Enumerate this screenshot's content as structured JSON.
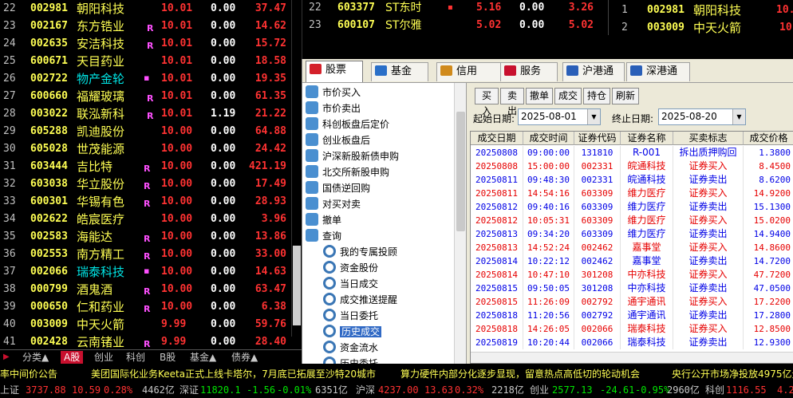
{
  "stock_list": [
    {
      "idx": "22",
      "code": "002981",
      "name": "朝阳科技",
      "mark": "",
      "price": "10.01",
      "vol": "0.00",
      "pct": "37.47",
      "name_color": "#ffff54"
    },
    {
      "idx": "23",
      "code": "002167",
      "name": "东方锆业",
      "mark": "R",
      "price": "10.01",
      "vol": "0.00",
      "pct": "14.62",
      "name_color": "#ffff54"
    },
    {
      "idx": "24",
      "code": "002635",
      "name": "安洁科技",
      "mark": "R",
      "price": "10.01",
      "vol": "0.00",
      "pct": "15.72",
      "name_color": "#ffff54"
    },
    {
      "idx": "25",
      "code": "600671",
      "name": "天目药业",
      "mark": "",
      "price": "10.01",
      "vol": "0.00",
      "pct": "18.58",
      "name_color": "#ffff54"
    },
    {
      "idx": "26",
      "code": "002722",
      "name": "物产金轮",
      "mark": "▪",
      "price": "10.01",
      "vol": "0.00",
      "pct": "19.35",
      "name_color": "#00e6e6"
    },
    {
      "idx": "27",
      "code": "600660",
      "name": "福耀玻璃",
      "mark": "R",
      "price": "10.01",
      "vol": "0.00",
      "pct": "61.35",
      "name_color": "#ffff54"
    },
    {
      "idx": "28",
      "code": "003022",
      "name": "联泓新科",
      "mark": "R",
      "price": "10.01",
      "vol": "1.19",
      "pct": "21.22",
      "name_color": "#ffff54"
    },
    {
      "idx": "29",
      "code": "605288",
      "name": "凯迪股份",
      "mark": "",
      "price": "10.00",
      "vol": "0.00",
      "pct": "64.88",
      "name_color": "#ffff54"
    },
    {
      "idx": "30",
      "code": "605028",
      "name": "世茂能源",
      "mark": "",
      "price": "10.00",
      "vol": "0.00",
      "pct": "24.42",
      "name_color": "#ffff54"
    },
    {
      "idx": "31",
      "code": "603444",
      "name": "吉比特",
      "mark": "R",
      "price": "10.00",
      "vol": "0.00",
      "pct": "421.19",
      "name_color": "#ffff54"
    },
    {
      "idx": "32",
      "code": "603038",
      "name": "华立股份",
      "mark": "R",
      "price": "10.00",
      "vol": "0.00",
      "pct": "17.49",
      "name_color": "#ffff54"
    },
    {
      "idx": "33",
      "code": "600301",
      "name": "华锡有色",
      "mark": "R",
      "price": "10.00",
      "vol": "0.00",
      "pct": "28.93",
      "name_color": "#ffff54"
    },
    {
      "idx": "34",
      "code": "002622",
      "name": "皓宸医疗",
      "mark": "",
      "price": "10.00",
      "vol": "0.00",
      "pct": "3.96",
      "name_color": "#ffff54"
    },
    {
      "idx": "35",
      "code": "002583",
      "name": "海能达",
      "mark": "R",
      "price": "10.00",
      "vol": "0.00",
      "pct": "13.86",
      "name_color": "#ffff54"
    },
    {
      "idx": "36",
      "code": "002553",
      "name": "南方精工",
      "mark": "R",
      "price": "10.00",
      "vol": "0.00",
      "pct": "33.00",
      "name_color": "#ffff54"
    },
    {
      "idx": "37",
      "code": "002066",
      "name": "瑞泰科技",
      "mark": "▪",
      "price": "10.00",
      "vol": "0.00",
      "pct": "14.63",
      "name_color": "#00e6e6"
    },
    {
      "idx": "38",
      "code": "000799",
      "name": "酒鬼酒",
      "mark": "R",
      "price": "10.00",
      "vol": "0.00",
      "pct": "63.47",
      "name_color": "#ffff54"
    },
    {
      "idx": "39",
      "code": "000650",
      "name": "仁和药业",
      "mark": "R",
      "price": "10.00",
      "vol": "0.00",
      "pct": "6.38",
      "name_color": "#ffff54"
    },
    {
      "idx": "40",
      "code": "003009",
      "name": "中天火箭",
      "mark": "",
      "price": "9.99",
      "vol": "0.00",
      "pct": "59.76",
      "name_color": "#ffff54"
    },
    {
      "idx": "41",
      "code": "002428",
      "name": "云南锗业",
      "mark": "R",
      "price": "9.99",
      "vol": "0.00",
      "pct": "28.40",
      "name_color": "#ffff54"
    }
  ],
  "bottom_tabs": [
    "分类▲",
    "A股",
    "创业",
    "科创",
    "B股",
    "基金▲",
    "债券▲"
  ],
  "top_mid": [
    {
      "idx": "22",
      "code": "603377",
      "name": "ST东时",
      "price": "5.16",
      "vol": "0.00",
      "pct": "3.26"
    },
    {
      "idx": "23",
      "code": "600107",
      "name": "ST尔雅",
      "price": "5.02",
      "vol": "0.00",
      "pct": "5.02"
    }
  ],
  "top_right": [
    {
      "idx": "1",
      "code": "002981",
      "name": "朝阳科技",
      "price": "10."
    },
    {
      "idx": "2",
      "code": "003009",
      "name": "中天火箭",
      "price": "10"
    }
  ],
  "trade_tabs": [
    {
      "label": "股票",
      "icon_color": "#d4202a"
    },
    {
      "label": "基金",
      "icon_color": "#2a6fc8"
    },
    {
      "label": "信用",
      "icon_color": "#d08a1c"
    },
    {
      "label": "服务",
      "icon_color": "#c8102e"
    },
    {
      "label": "沪港通",
      "icon_color": "#2a5fb8"
    },
    {
      "label": "深港通",
      "icon_color": "#2a5fb8"
    }
  ],
  "tree": [
    {
      "label": "市价买入",
      "icon": "#4a8fd0",
      "level": 0
    },
    {
      "label": "市价卖出",
      "icon": "#4a8fd0",
      "level": 0
    },
    {
      "label": "科创板盘后定价",
      "icon": "#4a8fd0",
      "level": 0
    },
    {
      "label": "创业板盘后",
      "icon": "#4a8fd0",
      "level": 0
    },
    {
      "label": "沪深新股新债申购",
      "icon": "#4a8fd0",
      "level": 0
    },
    {
      "label": "北交所新股申购",
      "icon": "#4a8fd0",
      "level": 0
    },
    {
      "label": "国债逆回购",
      "icon": "#4a8fd0",
      "level": 0
    },
    {
      "label": "对买对卖",
      "icon": "#4a8fd0",
      "level": 0
    },
    {
      "label": "撤单",
      "icon": "#4a8fd0",
      "level": 0
    },
    {
      "label": "查询",
      "icon": "#4a8fd0",
      "level": 0
    },
    {
      "label": "我的专属投顾",
      "icon": "gear",
      "level": 1
    },
    {
      "label": "资金股份",
      "icon": "gear",
      "level": 1
    },
    {
      "label": "当日成交",
      "icon": "gear",
      "level": 1
    },
    {
      "label": "成交推送提醒",
      "icon": "gear",
      "level": 1
    },
    {
      "label": "当日委托",
      "icon": "gear",
      "level": 1
    },
    {
      "label": "历史成交",
      "icon": "gear",
      "level": 1,
      "selected": true
    },
    {
      "label": "资金流水",
      "icon": "gear",
      "level": 1
    },
    {
      "label": "历史委托",
      "icon": "gear",
      "level": 1
    }
  ],
  "buttons": [
    "买入",
    "卖出",
    "撤单",
    "成交",
    "持仓",
    "刷新"
  ],
  "dates": {
    "start_label": "起始日期:",
    "start_value": "2025-08-01",
    "end_label": "终止日期:",
    "end_value": "2025-08-20"
  },
  "grid_headers": [
    "成交日期",
    "成交时间",
    "证券代码",
    "证券名称",
    "买卖标志",
    "成交价格"
  ],
  "grid_rows": [
    {
      "date": "20250808",
      "time": "09:00:00",
      "code": "131810",
      "name": "R-001",
      "flag": "拆出质押购回",
      "price": "1.3800",
      "type": "sell"
    },
    {
      "date": "20250808",
      "time": "15:00:00",
      "code": "002331",
      "name": "皖通科技",
      "flag": "证券买入",
      "price": "8.4500",
      "type": "buy"
    },
    {
      "date": "20250811",
      "time": "09:48:30",
      "code": "002331",
      "name": "皖通科技",
      "flag": "证券卖出",
      "price": "8.6200",
      "type": "sell"
    },
    {
      "date": "20250811",
      "time": "14:54:16",
      "code": "603309",
      "name": "维力医疗",
      "flag": "证券买入",
      "price": "14.9200",
      "type": "buy"
    },
    {
      "date": "20250812",
      "time": "09:40:16",
      "code": "603309",
      "name": "维力医疗",
      "flag": "证券卖出",
      "price": "15.1300",
      "type": "sell"
    },
    {
      "date": "20250812",
      "time": "10:05:31",
      "code": "603309",
      "name": "维力医疗",
      "flag": "证券买入",
      "price": "15.0200",
      "type": "buy"
    },
    {
      "date": "20250813",
      "time": "09:34:20",
      "code": "603309",
      "name": "维力医疗",
      "flag": "证券卖出",
      "price": "14.9400",
      "type": "sell"
    },
    {
      "date": "20250813",
      "time": "14:52:24",
      "code": "002462",
      "name": "嘉事堂",
      "flag": "证券买入",
      "price": "14.8600",
      "type": "buy"
    },
    {
      "date": "20250814",
      "time": "10:22:12",
      "code": "002462",
      "name": "嘉事堂",
      "flag": "证券卖出",
      "price": "14.7200",
      "type": "sell"
    },
    {
      "date": "20250814",
      "time": "10:47:10",
      "code": "301208",
      "name": "中亦科技",
      "flag": "证券买入",
      "price": "47.7200",
      "type": "buy"
    },
    {
      "date": "20250815",
      "time": "09:50:05",
      "code": "301208",
      "name": "中亦科技",
      "flag": "证券卖出",
      "price": "47.0500",
      "type": "sell"
    },
    {
      "date": "20250815",
      "time": "11:26:09",
      "code": "002792",
      "name": "通宇通讯",
      "flag": "证券买入",
      "price": "17.2200",
      "type": "buy"
    },
    {
      "date": "20250818",
      "time": "11:20:56",
      "code": "002792",
      "name": "通宇通讯",
      "flag": "证券卖出",
      "price": "17.2800",
      "type": "sell"
    },
    {
      "date": "20250818",
      "time": "14:26:05",
      "code": "002066",
      "name": "瑞泰科技",
      "flag": "证券买入",
      "price": "12.8500",
      "type": "buy"
    },
    {
      "date": "20250819",
      "time": "10:20:44",
      "code": "002066",
      "name": "瑞泰科技",
      "flag": "证券卖出",
      "price": "12.9300",
      "type": "sell"
    }
  ],
  "news": [
    "率中间价公告",
    "美团国际化业务Keeta正式上线卡塔尔，7月底已拓展至沙特20城市",
    "算力硬件内部分化逐步显现，留意热点高低切的轮动机会",
    "央行公开市场净投放4975亿元"
  ],
  "indices": [
    {
      "name": "上证",
      "value": "3737.88",
      "chg": "10.59",
      "pct": "0.28%",
      "vol": "4462亿",
      "up": true
    },
    {
      "name": "深证",
      "value": "11820.1",
      "chg": "-1.56",
      "pct": "-0.01%",
      "vol": "6351亿",
      "up": false
    },
    {
      "name": "沪深",
      "value": "4237.00",
      "chg": "13.63",
      "pct": "0.32%",
      "vol": "2218亿",
      "up": true
    },
    {
      "name": "创业",
      "value": "2577.13",
      "chg": "-24.61",
      "pct": "-0.95%",
      "vol": "2960亿",
      "up": false
    },
    {
      "name": "科创",
      "value": "1116.55",
      "chg": "4.2",
      "pct": "",
      "vol": "",
      "up": true
    }
  ]
}
